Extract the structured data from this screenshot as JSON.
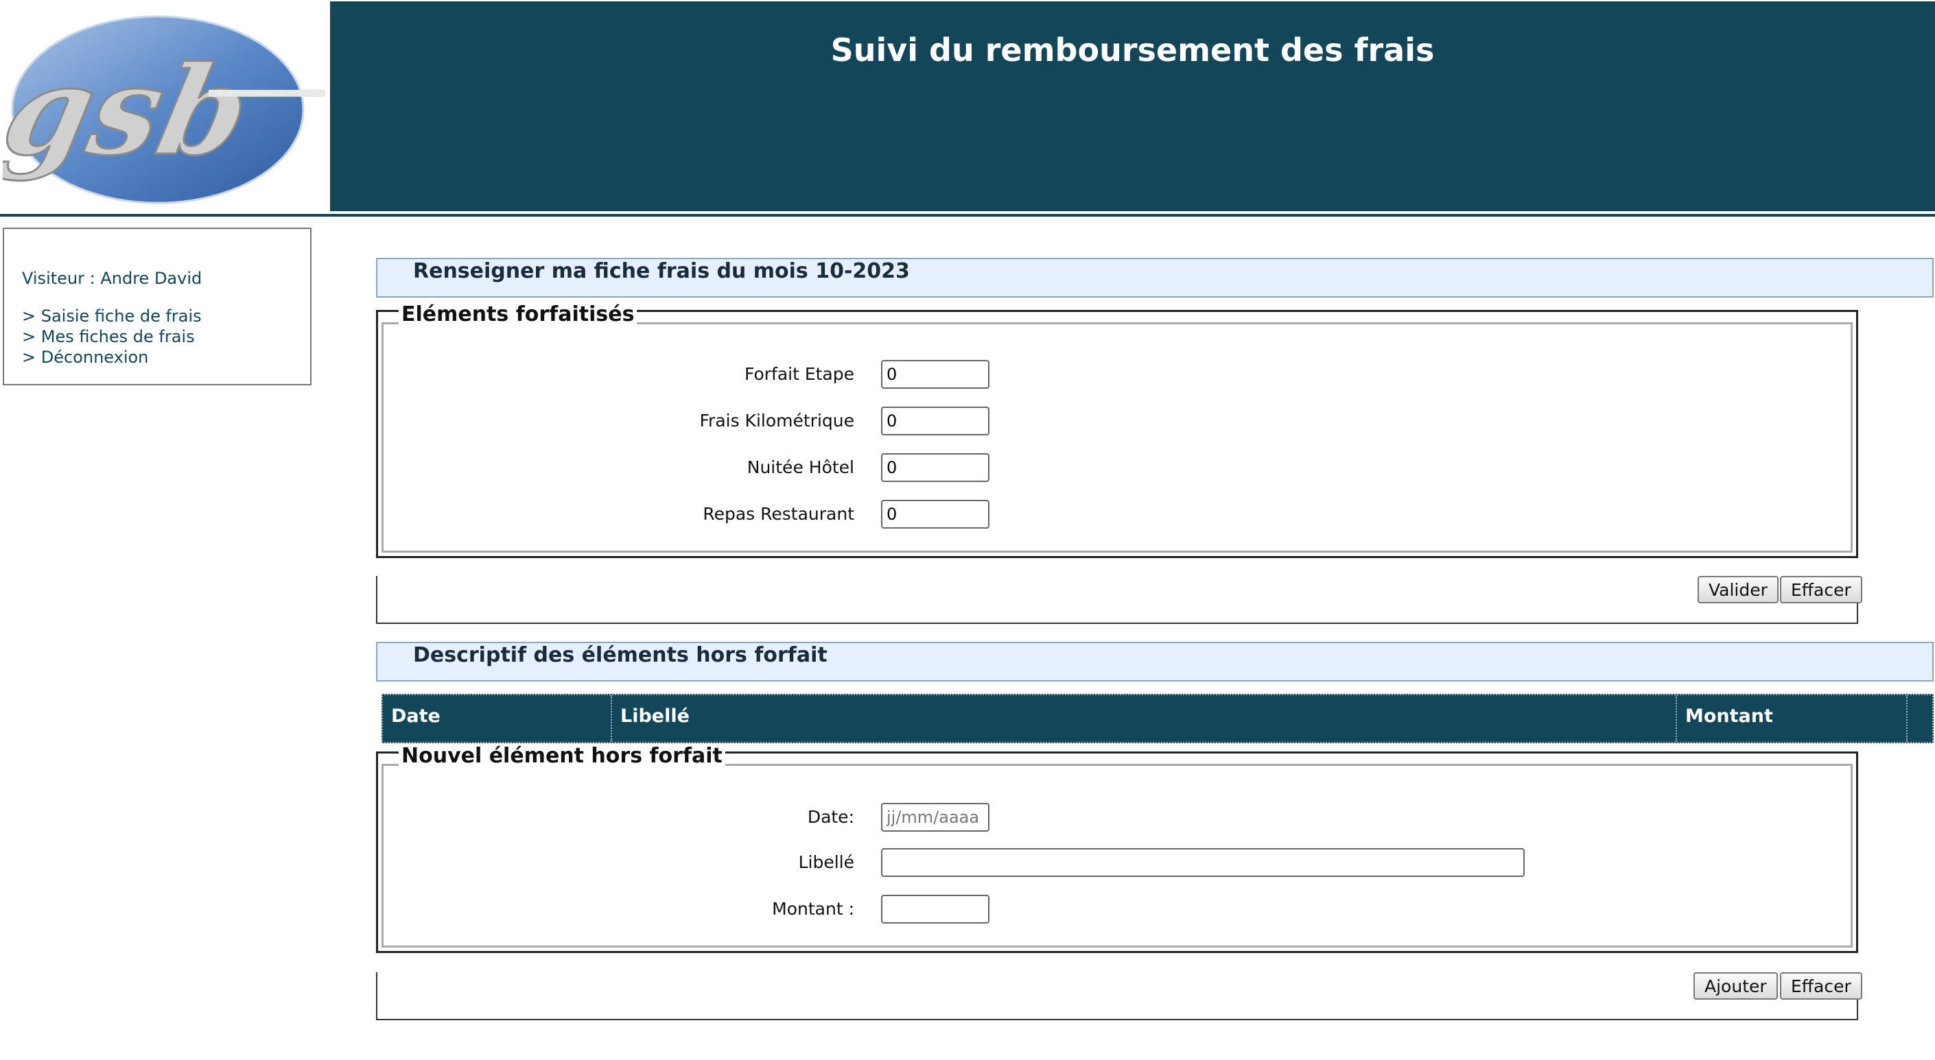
{
  "logo": {
    "text": "gsb"
  },
  "header": {
    "title": "Suivi du remboursement des frais"
  },
  "sidebar": {
    "visitor_label": "Visiteur :",
    "visitor_name": "Andre David",
    "menu": [
      {
        "label": "> Saisie fiche de frais"
      },
      {
        "label": "> Mes fiches de frais"
      },
      {
        "label": "> Déconnexion"
      }
    ]
  },
  "forfait_section": {
    "title": "Renseigner ma fiche frais du mois 10-2023",
    "legend": "Eléments forfaitisés",
    "fields": [
      {
        "label": "Forfait Etape",
        "value": "0"
      },
      {
        "label": "Frais Kilométrique",
        "value": "0"
      },
      {
        "label": "Nuitée Hôtel",
        "value": "0"
      },
      {
        "label": "Repas Restaurant",
        "value": "0"
      }
    ],
    "buttons": {
      "validate": "Valider",
      "clear": "Effacer"
    }
  },
  "hors_forfait_section": {
    "title": "Descriptif des éléments hors forfait",
    "table_headers": [
      "Date",
      "Libellé",
      "Montant"
    ],
    "legend": "Nouvel élément hors forfait",
    "fields": {
      "date": {
        "label": "Date:",
        "value": "",
        "placeholder": "jj/mm/aaaa"
      },
      "libelle": {
        "label": "Libellé",
        "value": ""
      },
      "montant": {
        "label": "Montant :",
        "value": ""
      }
    },
    "buttons": {
      "add": "Ajouter",
      "clear": "Effacer"
    }
  },
  "colors": {
    "header_bg": "#134658",
    "section_bg": "#e6f0fc",
    "logo_blue": "#4a78c0"
  }
}
